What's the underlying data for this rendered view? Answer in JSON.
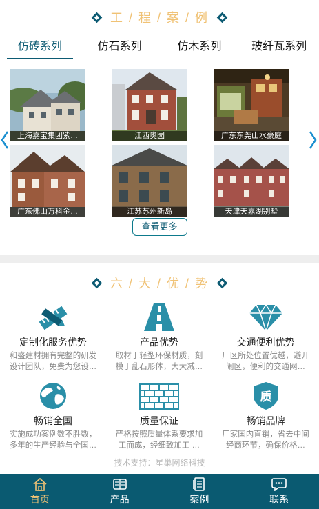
{
  "cases": {
    "title": "工 / 程 / 案 / 例",
    "tabs": [
      "仿砖系列",
      "仿石系列",
      "仿木系列",
      "玻纤瓦系列"
    ],
    "items": [
      {
        "caption": "上海嘉宝集团紫…"
      },
      {
        "caption": "江西奥园"
      },
      {
        "caption": "广东东莞山水豪庭"
      },
      {
        "caption": "广东佛山万科金…"
      },
      {
        "caption": "江苏苏州新岛"
      },
      {
        "caption": "天津天嘉湖别墅"
      }
    ],
    "more_label": "查看更多"
  },
  "advantages": {
    "title": "六 / 大 / 优 / 势",
    "items": [
      {
        "icon": "pencil-ruler-icon",
        "name": "定制化服务优势",
        "desc": "和盛建材拥有完整的研发设计团队，免费为您设…"
      },
      {
        "icon": "road-icon",
        "name": "产品优势",
        "desc": "取材于轻型环保材质，刻模于乱石形体，大大减…"
      },
      {
        "icon": "diamond-icon",
        "name": "交通便利优势",
        "desc": "厂区所处位置优越，避开闹区，便利的交通网…"
      },
      {
        "icon": "globe-icon",
        "name": "畅销全国",
        "desc": "实施成功案例数不胜数，多年的生产经验与全国…"
      },
      {
        "icon": "brick-wall-icon",
        "name": "质量保证",
        "desc": "严格按照质量体系要求加工而成，经细致加工 …"
      },
      {
        "icon": "quality-shield-icon",
        "name": "畅销品牌",
        "desc": "厂家国内直销，省去中间经商环节，确保价格…"
      }
    ],
    "quality_glyph": "质"
  },
  "support_text": "技术支持：星巢网络科技",
  "nav": [
    {
      "icon": "home-icon",
      "label": "首页"
    },
    {
      "icon": "product-icon",
      "label": "产品"
    },
    {
      "icon": "case-icon",
      "label": "案例"
    },
    {
      "icon": "contact-icon",
      "label": "联系"
    }
  ],
  "colors": {
    "accent": "#0a5a71",
    "gold": "#f0c275"
  }
}
